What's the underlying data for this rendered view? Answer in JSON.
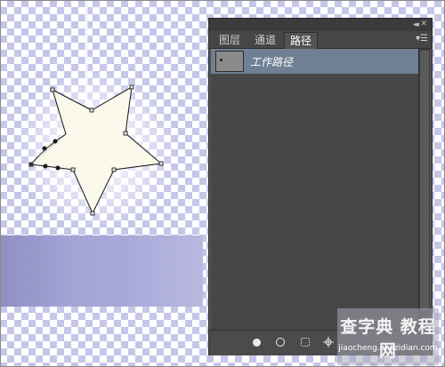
{
  "canvas": {
    "description_colors": {
      "checker_light": "#ffffff",
      "checker_dark": "#c6c6ea",
      "star_fill": "#fbf9ec",
      "haze": "#a4a5d6"
    }
  },
  "panel": {
    "collapse_icon": "◂◂",
    "close_icon": "✕",
    "tabs": [
      {
        "label": "图层",
        "active": false
      },
      {
        "label": "通道",
        "active": false
      },
      {
        "label": "路径",
        "active": true
      }
    ],
    "menu_icon": "▾☰",
    "paths": [
      {
        "name": "工作路径",
        "selected": true
      }
    ],
    "buttons": {
      "fill_path": "fill-path-icon",
      "stroke_path": "stroke-path-icon",
      "load_selection": "load-selection-icon",
      "make_mask": "mask-icon"
    },
    "colors": {
      "panel_bg": "#535353",
      "selected_row": "#6f7f94"
    }
  },
  "watermark": {
    "main": "查字典 教程网",
    "url": "jiaocheng.chazidian.com"
  }
}
